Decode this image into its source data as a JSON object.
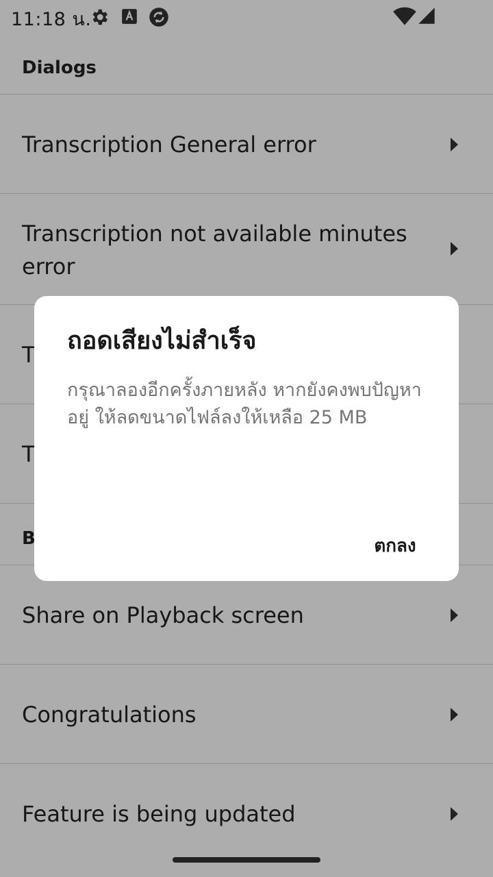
{
  "status_bar": {
    "time": "11:18 น.",
    "icons": [
      "gear-icon",
      "app-notification-icon",
      "sync-icon",
      "wifi-icon",
      "cell-signal-icon"
    ]
  },
  "list": {
    "section_header": "Dialogs",
    "items": [
      {
        "label": "Transcription General error"
      },
      {
        "label": "Transcription not available minutes error"
      },
      {
        "label": "T"
      },
      {
        "label": "T"
      }
    ],
    "section_header_2": "B",
    "items_2": [
      {
        "label": "Share on Playback screen"
      },
      {
        "label": "Congratulations"
      },
      {
        "label": "Feature is being updated"
      }
    ]
  },
  "dialog": {
    "title": "ถอดเสียงไม่สำเร็จ",
    "message": "กรุณาลองอีกครั้งภายหลัง หากยังคงพบปัญหาอยู่ ให้ลดขนาดไฟล์ลงให้เหลือ 25 MB",
    "ok_button": "ตกลง"
  },
  "colors": {
    "scrim": "#000000",
    "dialog_background": "#ffffff",
    "text_primary": "#222222",
    "text_secondary": "#757575"
  }
}
